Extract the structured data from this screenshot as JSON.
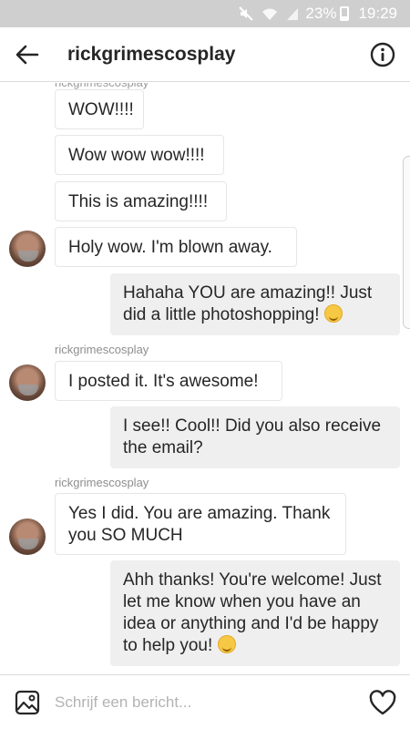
{
  "status_bar": {
    "battery": "23%",
    "time": "19:29"
  },
  "header": {
    "title": "rickgrimescosplay"
  },
  "thread": {
    "cut_label": "rickgrimescosplay",
    "messages": [
      {
        "from": "them",
        "text": "WOW!!!!"
      },
      {
        "from": "them",
        "text": "Wow wow wow!!!!"
      },
      {
        "from": "them",
        "text": "This is amazing!!!!"
      },
      {
        "from": "them",
        "text": "Holy wow. I'm blown away."
      },
      {
        "from": "me",
        "text": "Hahaha YOU are amazing!! Just did a little photoshopping!",
        "emoji": "grinning-sweat-emoji"
      },
      {
        "from": "them",
        "sender": "rickgrimescosplay",
        "text": "I posted it. It's awesome!"
      },
      {
        "from": "me",
        "text": "I see!! Cool!! Did you also receive the email?"
      },
      {
        "from": "them",
        "sender": "rickgrimescosplay",
        "text": "Yes I did. You are amazing. Thank you SO MUCH"
      },
      {
        "from": "me",
        "text": "Ahh thanks! You're welcome! Just let me know when you have an idea or anything and I'd be happy to help you!",
        "emoji": "hugging-emoji"
      }
    ]
  },
  "composer": {
    "placeholder": "Schrijf een bericht..."
  },
  "icons": {
    "status": [
      "mute-icon",
      "wifi-icon",
      "signal-icon",
      "battery-icon"
    ],
    "header": [
      "back-arrow-icon",
      "info-icon"
    ],
    "composer": [
      "gallery-icon",
      "heart-icon"
    ]
  }
}
